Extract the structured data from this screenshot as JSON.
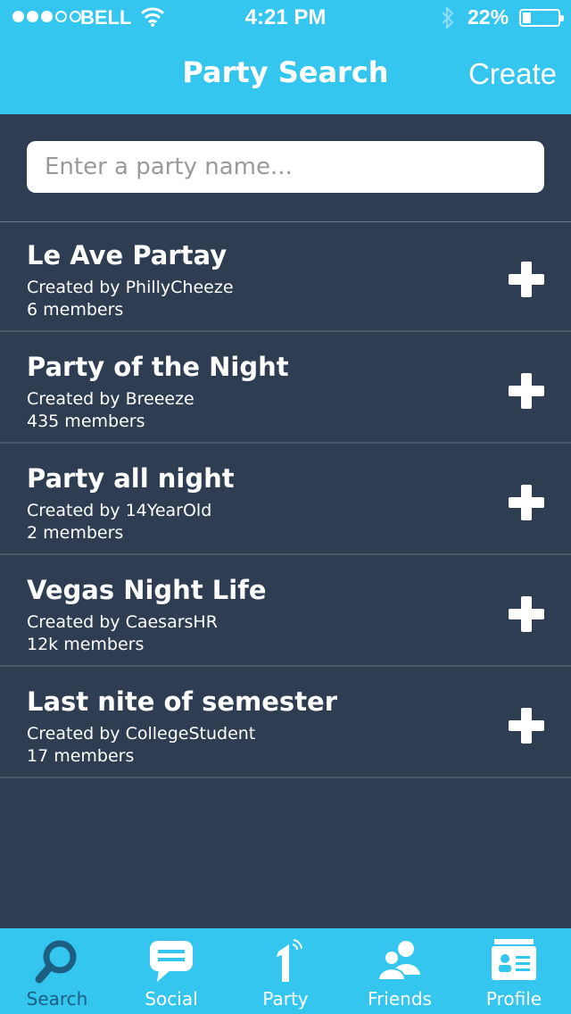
{
  "status": {
    "carrier": "BELL",
    "time": "4:21 PM",
    "battery": "22%",
    "battery_level": 0.22
  },
  "nav": {
    "title": "Party Search",
    "create_label": "Create"
  },
  "search": {
    "placeholder": "Enter a party name..."
  },
  "parties": [
    {
      "name": "Le Ave Partay",
      "creator": "Created by PhillyCheeze",
      "members": "6 members"
    },
    {
      "name": "Party of the Night",
      "creator": "Created by Breeeze",
      "members": "435 members"
    },
    {
      "name": "Party all night",
      "creator": "Created by 14YearOld",
      "members": "2 members"
    },
    {
      "name": "Vegas Night Life",
      "creator": "Created by CaesarsHR",
      "members": "12k members"
    },
    {
      "name": "Last nite of semester",
      "creator": "Created by CollegeStudent",
      "members": "17 members"
    }
  ],
  "tabs": [
    {
      "label": "Search",
      "icon": "search-icon",
      "active": true
    },
    {
      "label": "Social",
      "icon": "chat-bubble-icon",
      "active": false
    },
    {
      "label": "Party",
      "icon": "party-one-icon",
      "active": false
    },
    {
      "label": "Friends",
      "icon": "friends-icon",
      "active": false
    },
    {
      "label": "Profile",
      "icon": "profile-card-icon",
      "active": false
    }
  ],
  "colors": {
    "accent": "#35c6f0",
    "background": "#2e3d52",
    "active_tab": "#1c5f82"
  }
}
